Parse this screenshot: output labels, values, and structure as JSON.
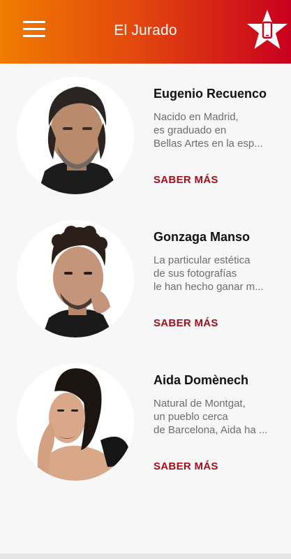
{
  "header": {
    "title": "El Jurado",
    "menu_icon": "hamburger-menu-icon",
    "action_icon": "star-phone-icon",
    "gradient": [
      "#f07c00",
      "#c8001e"
    ]
  },
  "jury": [
    {
      "name": "Eugenio Recuenco",
      "bio_lines": [
        "Nacido en Madrid,",
        "es graduado en",
        "Bellas Artes en la esp..."
      ],
      "more_label": "SABER MÁS"
    },
    {
      "name": "Gonzaga Manso",
      "bio_lines": [
        "La particular estética",
        "de sus fotografías",
        "le han hecho ganar m..."
      ],
      "more_label": "SABER MÁS"
    },
    {
      "name": "Aida Domènech",
      "bio_lines": [
        "Natural de Montgat,",
        "un pueblo cerca",
        "de Barcelona, Aida ha ..."
      ],
      "more_label": "SABER MÁS"
    }
  ],
  "colors": {
    "accent": "#a10f1d",
    "background": "#f7f7f7"
  }
}
